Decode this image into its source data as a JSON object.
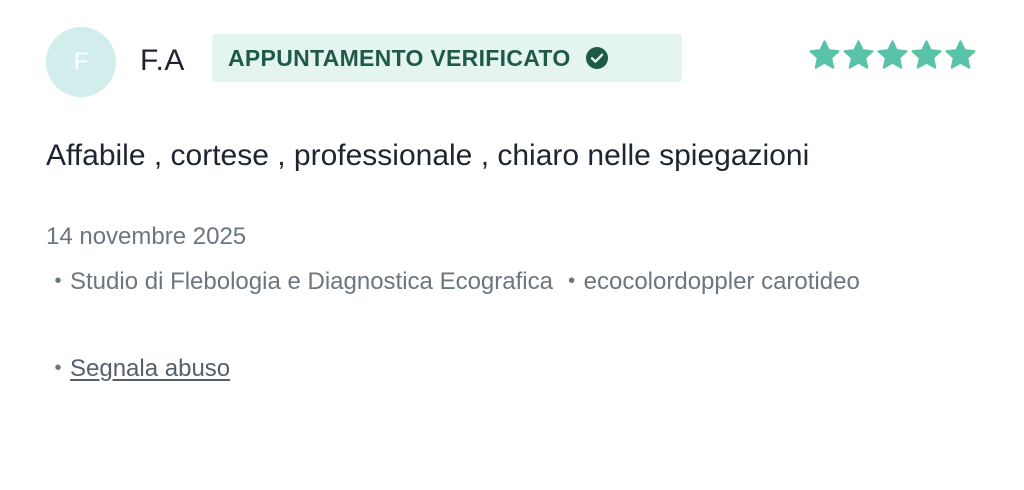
{
  "review": {
    "avatar_initial": "F",
    "reviewer_name": "F.A",
    "badge_label": "APPUNTAMENTO VERIFICATO",
    "rating": 5,
    "rating_max": 5,
    "text": "Affabile , cortese , professionale , chiaro nelle spiegazioni",
    "date": "14 novembre 2025",
    "bullet": "•",
    "location": "Studio di Flebologia e Diagnostica Ecografica",
    "service": "ecocolordoppler carotideo",
    "report_link": "Segnala abuso"
  },
  "icons": {
    "verified": "check-circle-icon",
    "rating": "star-icon"
  },
  "colors": {
    "accent_green": "#59c3a9",
    "badge_bg": "#e3f4f1",
    "badge_text": "#1f5a47",
    "avatar_bg": "#d2eeec",
    "muted_text": "#6b7680"
  }
}
